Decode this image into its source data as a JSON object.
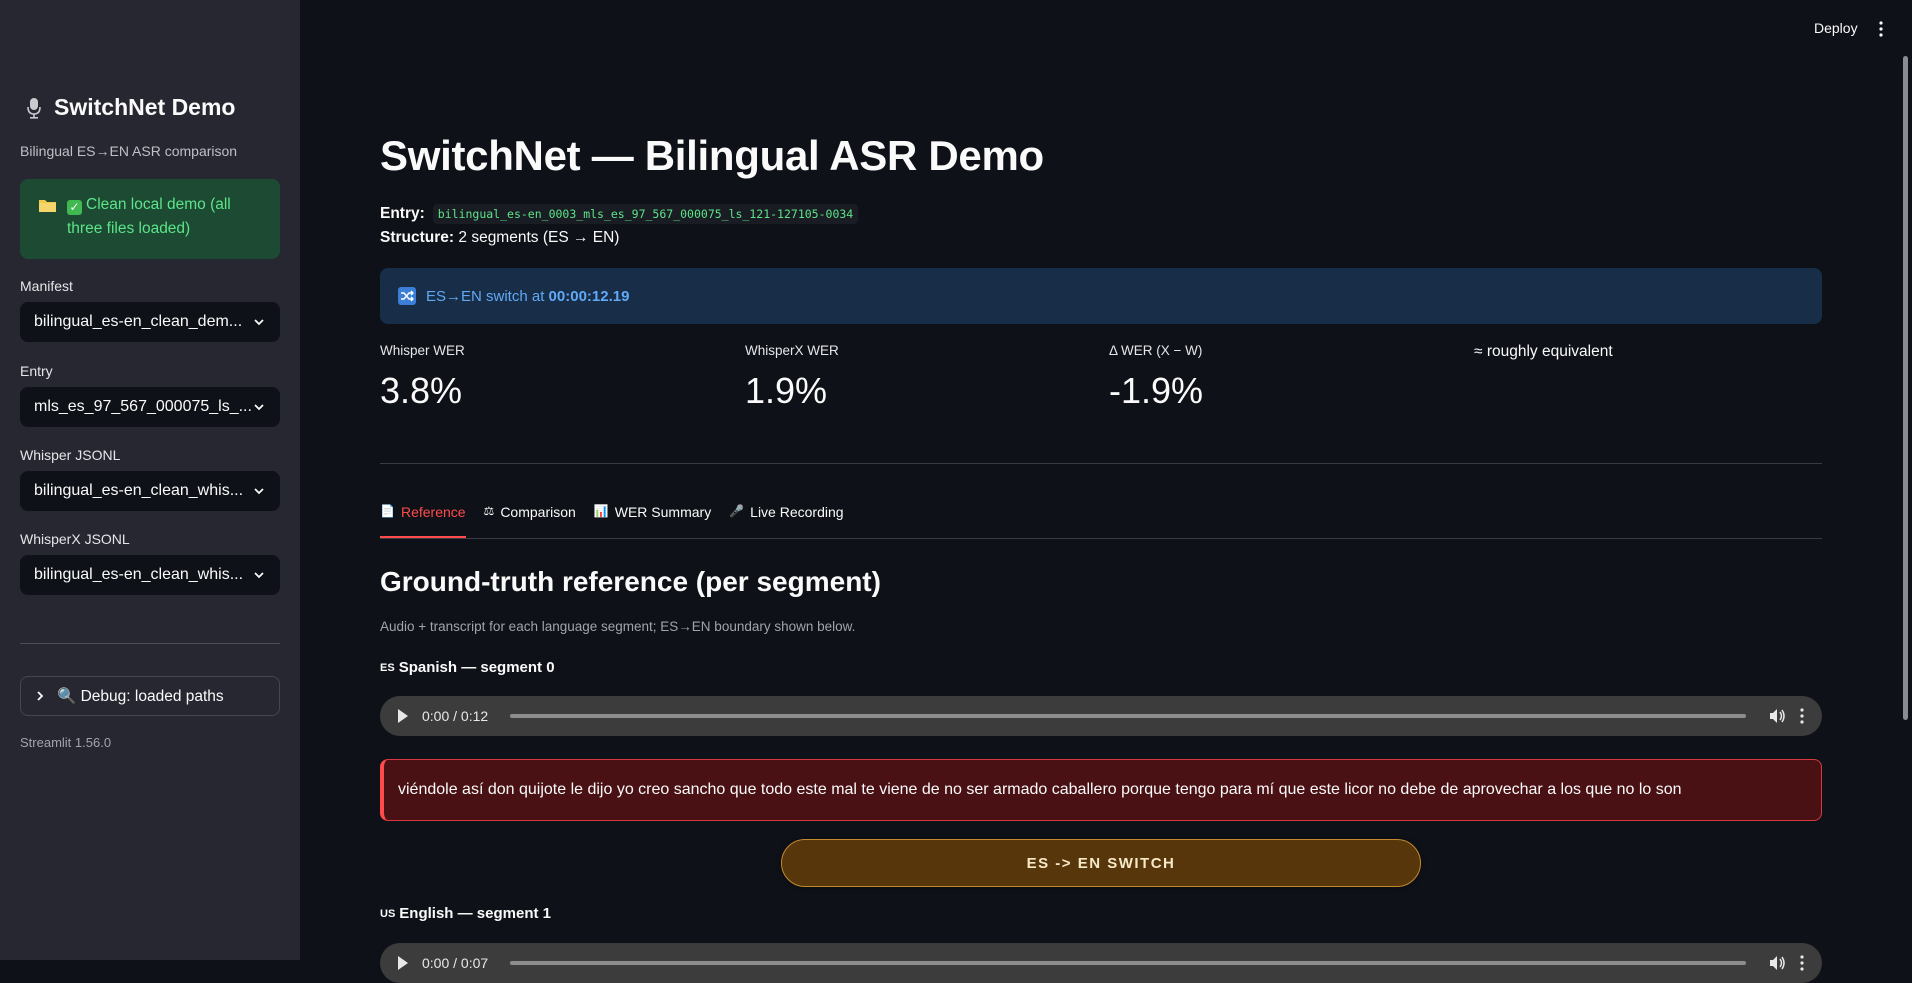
{
  "sidebar": {
    "title": "SwitchNet Demo",
    "subtitle": "Bilingual ES→EN ASR comparison",
    "status_text": "Clean local demo (all three files loaded)",
    "fields": [
      {
        "label": "Manifest",
        "value": "bilingual_es-en_clean_dem..."
      },
      {
        "label": "Entry",
        "value": "mls_es_97_567_000075_ls_..."
      },
      {
        "label": "Whisper JSONL",
        "value": "bilingual_es-en_clean_whis..."
      },
      {
        "label": "WhisperX JSONL",
        "value": "bilingual_es-en_clean_whis..."
      }
    ],
    "debug_label": "🔍 Debug: loaded paths",
    "version": "Streamlit 1.56.0"
  },
  "topbar": {
    "deploy_label": "Deploy"
  },
  "main": {
    "title": "SwitchNet — Bilingual ASR Demo",
    "entry_label": "Entry:",
    "entry_value": "bilingual_es-en_0003_mls_es_97_567_000075_ls_121-127105-0034",
    "structure_label": "Structure:",
    "structure_value": "2 segments (ES → EN)",
    "info_text": "ES→EN switch at",
    "info_time": "00:00:12.19",
    "metrics": [
      {
        "label": "Whisper WER",
        "value": "3.8%"
      },
      {
        "label": "WhisperX WER",
        "value": "1.9%"
      },
      {
        "label": "Δ WER (X − W)",
        "value": "-1.9%"
      }
    ],
    "verdict": "≈ roughly equivalent",
    "tabs": [
      {
        "icon": "📄",
        "label": "Reference"
      },
      {
        "icon": "⚖",
        "label": "Comparison"
      },
      {
        "icon": "📊",
        "label": "WER Summary"
      },
      {
        "icon": "🎤",
        "label": "Live Recording"
      }
    ],
    "section_title": "Ground-truth reference (per segment)",
    "caption": "Audio + transcript for each language segment; ES→EN boundary shown below.",
    "segments": [
      {
        "flag": "ES",
        "title": "Spanish — segment 0",
        "time": "0:00 / 0:12",
        "transcript": "viéndole así don quijote le dijo yo creo sancho que todo este mal te viene de no ser armado caballero porque tengo para mí que este licor no debe de aprovechar a los que no lo son"
      },
      {
        "flag": "US",
        "title": "English — segment 1",
        "time": "0:00 / 0:07"
      }
    ],
    "switch_label": "ES -> EN SWITCH"
  },
  "colors": {
    "background": "#0e1117",
    "sidebar": "#262730",
    "accent": "#ff4b4b",
    "success_text": "#5ce488",
    "info_text": "#61a8f5"
  }
}
